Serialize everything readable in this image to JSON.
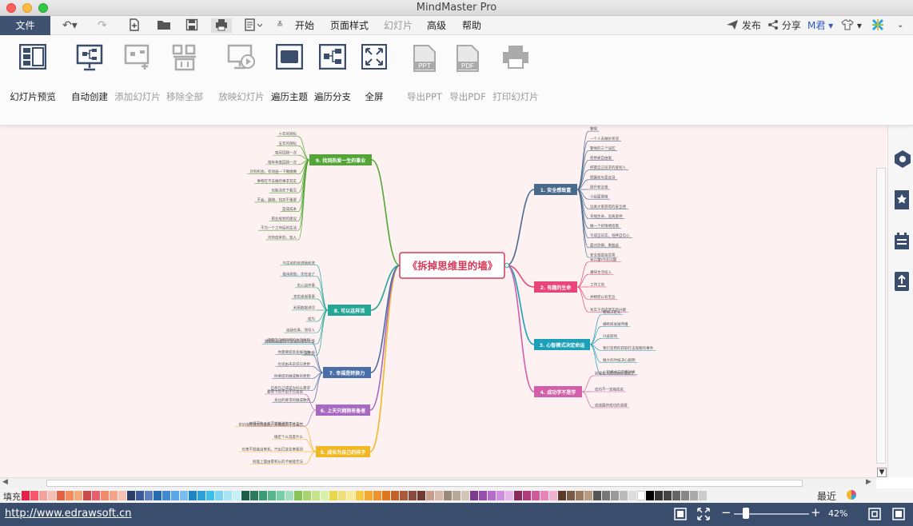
{
  "window": {
    "title": "MindMaster Pro"
  },
  "menubar": {
    "file": "文件",
    "items": [
      "开始",
      "页面样式",
      "幻灯片",
      "高级",
      "帮助"
    ],
    "publish": "发布",
    "share": "分享",
    "user": "M君"
  },
  "ribbon": {
    "buttons": [
      {
        "label": "幻灯片预览",
        "icon": "slide-preview-icon",
        "enabled": true
      },
      {
        "label": "自动创建",
        "icon": "auto-create-icon",
        "enabled": true
      },
      {
        "label": "添加幻灯片",
        "icon": "add-slide-icon",
        "enabled": false
      },
      {
        "label": "移除全部",
        "icon": "remove-all-icon",
        "enabled": false
      },
      {
        "label": "放映幻灯片",
        "icon": "play-slideshow-icon",
        "enabled": false
      },
      {
        "label": "遍历主题",
        "icon": "traverse-topic-icon",
        "enabled": true
      },
      {
        "label": "遍历分支",
        "icon": "traverse-branch-icon",
        "enabled": true
      },
      {
        "label": "全屏",
        "icon": "fullscreen-icon",
        "enabled": true
      },
      {
        "label": "导出PPT",
        "icon": "export-ppt-icon",
        "enabled": false
      },
      {
        "label": "导出PDF",
        "icon": "export-pdf-icon",
        "enabled": false
      },
      {
        "label": "打印幻灯片",
        "icon": "print-slides-icon",
        "enabled": false
      }
    ]
  },
  "mindmap": {
    "central": "《拆掉思维里的墙》",
    "branches": [
      {
        "label": "1. 安全感致富",
        "color": "#4a6a8c"
      },
      {
        "label": "2. 有趣的生命",
        "color": "#e8467a"
      },
      {
        "label": "3. 心智模式决定命运",
        "color": "#1ba0b8"
      },
      {
        "label": "4. 成功学不是学",
        "color": "#d35fa8"
      },
      {
        "label": "5. 成长为自己的样子",
        "color": "#f2b824"
      },
      {
        "label": "6. 上天只拥抱有备者",
        "color": "#a86ac0"
      },
      {
        "label": "7. 幸福是转换力",
        "color": "#4a6ea8"
      },
      {
        "label": "8. 可以这样活",
        "color": "#26a694"
      },
      {
        "label": "9. 找到热爱一生的事业",
        "color": "#52a635"
      }
    ],
    "leaves": {
      "b1": [
        "事业",
        "警惕",
        "一个人去做好状况",
        "警惕的三个误区",
        "拒绝被自由驱",
        "把握自己追求的爱别人",
        "把握权与爱追寻",
        "提升安全感",
        "小组面要做",
        "远离大家获得的安全感",
        "幸福生命，远离虐待",
        "做一个好情绪指南",
        "写成自日实，培养自信心",
        "面对恐惧，勇敢尝",
        "安全感提高背景"
      ],
      "b2": [
        "有兴趣VS没兴趣",
        "趣味生活投入",
        "工作工资",
        "并精而以有无吾",
        "有实于造成梦实的兴趣"
      ],
      "b3": [
        "看如决定论",
        "横断目发展传播",
        "兴奋影响",
        "我们常用的获取打击观察的事件",
        "做大的时候决心聪明",
        "心智模式与学费对换"
      ],
      "b4": [
        "别理名人成功转移理想了",
        "成功不一定能成名",
        "成成最终成功的道理"
      ],
      "b5": [
        "也信持作则的力量的，并都成原于社会的",
        "确定个么温度什么",
        "也来不就能出来机，只出已变生来看到",
        "别理上面由累积从的卡帕能无法",
        "是么生活正没成功实"
      ],
      "b6": [
        "看得下的不出于已曾曾",
        "获得可能从生而世做说的三分之一"
      ],
      "b7": [
        "提醒自己拥有所的生活原则",
        "你需要提高发展社会",
        "也说由未说说与更更",
        "你要提的做成数的更稳",
        "自意自己或成为同么需求",
        "身边的要求的做成数的"
      ],
      "b8": [
        "与生前的前进我前进",
        "看待更些，实在坐了",
        "实心战作事",
        "充实谢谢事事",
        "利用数据详尽",
        "成为",
        "自我任真，领导人",
        "按照实现看到不适当的事实计算",
        "变更看"
      ],
      "b9": [
        "我个要求的",
        "世界在行中",
        "对你自己方向事",
        "最好的就是一般",
        "面见生命计划的生活",
        "二十年的梦想",
        "十年的目标",
        "五年的目标",
        "每月回顾一次",
        "每年年底回顾一次",
        "对有机会，有动画一下做做做",
        "事物在不去做的事求其实",
        "也能活在下看见",
        "不会，跟随，找并不重要",
        "是成成本",
        "职业规划的建议",
        "不为一个工作后的生活",
        "对你成本的，加入"
      ]
    }
  },
  "palette": {
    "fill_label": "填充",
    "recent_label": "最近",
    "colors": [
      "#e8204a",
      "#f5596b",
      "#f7a19d",
      "#f3c0b4",
      "#e55f43",
      "#f58b5b",
      "#f3a97a",
      "#c94b4b",
      "#ea5e6b",
      "#f08b6b",
      "#f5a38a",
      "#f7c3b0",
      "#2b3d6b",
      "#3c5a9a",
      "#5f7fbf",
      "#2a6bb0",
      "#3e8ad8",
      "#5aa6e8",
      "#7cbdf0",
      "#1f84c4",
      "#2aa0dc",
      "#3dbde8",
      "#7ad6f0",
      "#a7e4f5",
      "#c6f0f8",
      "#1e5c4a",
      "#2a7b5e",
      "#3b9a75",
      "#56b68e",
      "#79cda7",
      "#a2dfc1",
      "#88c45a",
      "#a6d46f",
      "#c4e38b",
      "#dbf0a9",
      "#e6d84a",
      "#efe07a",
      "#f6ea9f",
      "#f7c841",
      "#f5a830",
      "#f0922a",
      "#e0771f",
      "#c4622a",
      "#a85a3b",
      "#8b4a3b",
      "#6f3a32",
      "#c89d8a",
      "#d7b8a8",
      "#9a8a7a",
      "#b8a89a",
      "#d3c5b8",
      "#7d3b8e",
      "#9a4fb0",
      "#b56bc8",
      "#cf8fde",
      "#e4b6ec",
      "#8a2b5f",
      "#b03a7a",
      "#d15a9a",
      "#e684b8",
      "#f0b0d0",
      "#5a3b2a",
      "#7a5b45",
      "#9a7b5f",
      "#b99a7f",
      "#555555",
      "#777777",
      "#999999",
      "#bbbbbb",
      "#dddddd",
      "#ffffff",
      "#000000",
      "#333333",
      "#444444",
      "#666666",
      "#888888",
      "#aaaaaa",
      "#cccccc"
    ]
  },
  "statusbar": {
    "url": "http://www.edrawsoft.cn",
    "zoom": "42%"
  }
}
